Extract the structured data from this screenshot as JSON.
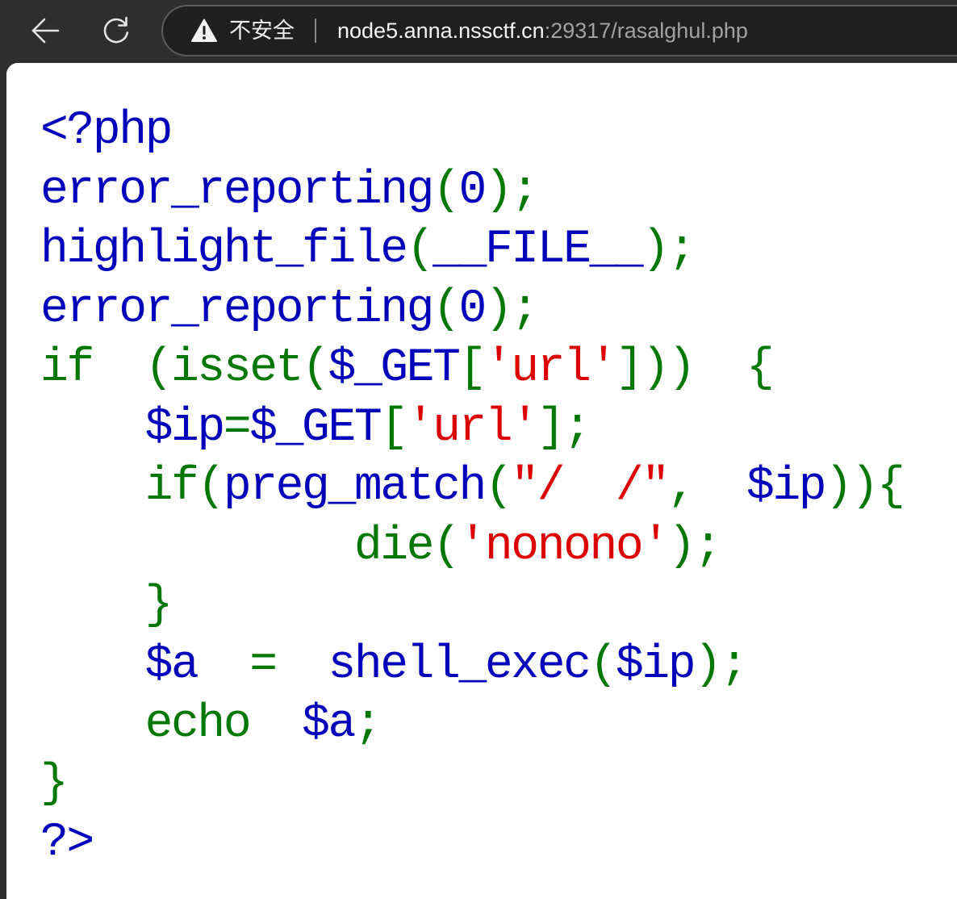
{
  "browser": {
    "security_label": "不安全",
    "url_host": "node5.anna.nssctf.cn",
    "url_path": ":29317/rasalghul.php",
    "icons": {
      "back": "back-arrow-icon",
      "reload": "reload-icon",
      "security": "warning-icon"
    }
  },
  "code": {
    "lines": [
      {
        "tokens": [
          {
            "text": "<?php",
            "color": "#0000BB"
          }
        ]
      },
      {
        "tokens": [
          {
            "text": "error_reporting",
            "color": "#0000BB"
          },
          {
            "text": "(",
            "color": "#007700"
          },
          {
            "text": "0",
            "color": "#0000BB"
          },
          {
            "text": ");",
            "color": "#007700"
          }
        ]
      },
      {
        "tokens": [
          {
            "text": "highlight_file",
            "color": "#0000BB"
          },
          {
            "text": "(",
            "color": "#007700"
          },
          {
            "text": "__FILE__",
            "color": "#0000BB"
          },
          {
            "text": ");",
            "color": "#007700"
          }
        ]
      },
      {
        "tokens": [
          {
            "text": "error_reporting",
            "color": "#0000BB"
          },
          {
            "text": "(",
            "color": "#007700"
          },
          {
            "text": "0",
            "color": "#0000BB"
          },
          {
            "text": ");",
            "color": "#007700"
          }
        ]
      },
      {
        "tokens": [
          {
            "text": "if  (isset(",
            "color": "#007700"
          },
          {
            "text": "$_GET",
            "color": "#0000BB"
          },
          {
            "text": "[",
            "color": "#007700"
          },
          {
            "text": "'url'",
            "color": "#DD0000"
          },
          {
            "text": "]))  {",
            "color": "#007700"
          }
        ]
      },
      {
        "tokens": [
          {
            "text": "    $ip",
            "color": "#0000BB"
          },
          {
            "text": "=",
            "color": "#007700"
          },
          {
            "text": "$_GET",
            "color": "#0000BB"
          },
          {
            "text": "[",
            "color": "#007700"
          },
          {
            "text": "'url'",
            "color": "#DD0000"
          },
          {
            "text": "];",
            "color": "#007700"
          }
        ]
      },
      {
        "tokens": [
          {
            "text": "    if(",
            "color": "#007700"
          },
          {
            "text": "preg_match",
            "color": "#0000BB"
          },
          {
            "text": "(",
            "color": "#007700"
          },
          {
            "text": "\"/  /\"",
            "color": "#DD0000"
          },
          {
            "text": ",  ",
            "color": "#007700"
          },
          {
            "text": "$ip",
            "color": "#0000BB"
          },
          {
            "text": ")){",
            "color": "#007700"
          }
        ]
      },
      {
        "tokens": [
          {
            "text": "            die(",
            "color": "#007700"
          },
          {
            "text": "'nonono'",
            "color": "#DD0000"
          },
          {
            "text": ");",
            "color": "#007700"
          }
        ]
      },
      {
        "tokens": [
          {
            "text": "    }",
            "color": "#007700"
          }
        ]
      },
      {
        "tokens": [
          {
            "text": "    $a",
            "color": "#0000BB"
          },
          {
            "text": "  =  ",
            "color": "#007700"
          },
          {
            "text": "shell_exec",
            "color": "#0000BB"
          },
          {
            "text": "(",
            "color": "#007700"
          },
          {
            "text": "$ip",
            "color": "#0000BB"
          },
          {
            "text": ");",
            "color": "#007700"
          }
        ]
      },
      {
        "tokens": [
          {
            "text": "    echo  ",
            "color": "#007700"
          },
          {
            "text": "$a",
            "color": "#0000BB"
          },
          {
            "text": ";",
            "color": "#007700"
          }
        ]
      },
      {
        "tokens": [
          {
            "text": "}",
            "color": "#007700"
          }
        ]
      },
      {
        "tokens": [
          {
            "text": "?>",
            "color": "#0000BB"
          }
        ]
      }
    ]
  }
}
